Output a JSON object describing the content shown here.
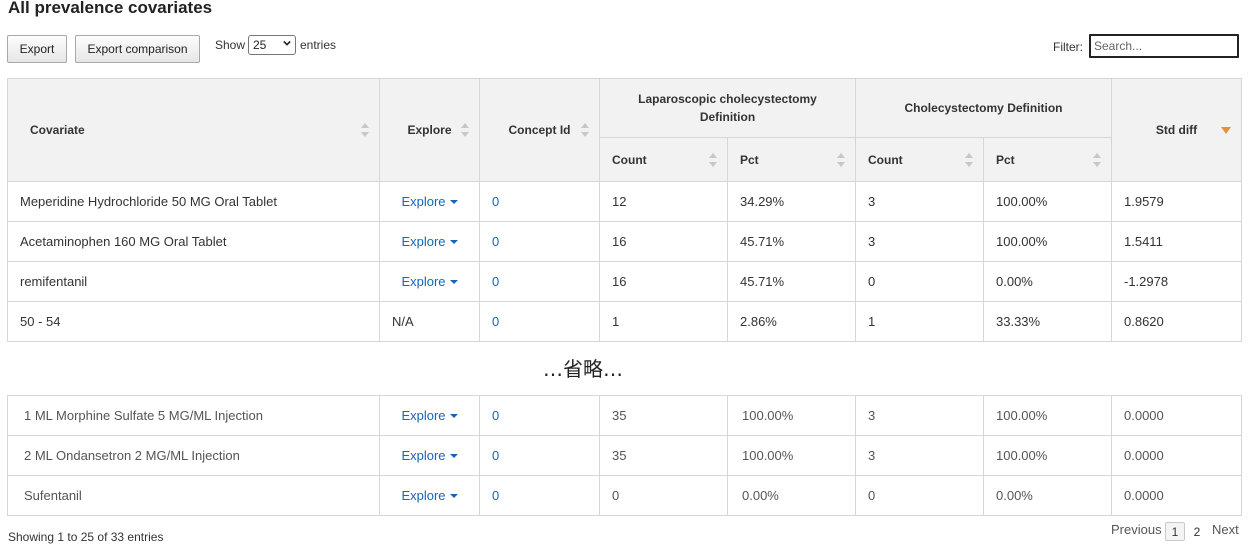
{
  "title": "All prevalence covariates",
  "toolbar": {
    "export_label": "Export",
    "export_comparison_label": "Export comparison",
    "show_label": "Show",
    "entries_value": "25",
    "entries_label": "entries",
    "filter_label": "Filter:",
    "filter_placeholder": "Search..."
  },
  "columns": {
    "covariate": "Covariate",
    "explore": "Explore",
    "concept_id": "Concept Id",
    "group1": "Laparoscopic cholecystectomy Definition",
    "group2": "Cholecystectomy Definition",
    "count": "Count",
    "pct": "Pct",
    "std_diff": "Std diff"
  },
  "rows_top": [
    {
      "covariate": "Meperidine Hydrochloride 50 MG Oral Tablet",
      "explore": "Explore",
      "concept_id": "0",
      "count1": "12",
      "pct1": "34.29%",
      "count2": "3",
      "pct2": "100.00%",
      "std_diff": "1.9579"
    },
    {
      "covariate": "Acetaminophen 160 MG Oral Tablet",
      "explore": "Explore",
      "concept_id": "0",
      "count1": "16",
      "pct1": "45.71%",
      "count2": "3",
      "pct2": "100.00%",
      "std_diff": "1.5411"
    },
    {
      "covariate": "remifentanil",
      "explore": "Explore",
      "concept_id": "0",
      "count1": "16",
      "pct1": "45.71%",
      "count2": "0",
      "pct2": "0.00%",
      "std_diff": "-1.2978"
    },
    {
      "covariate": "50 - 54",
      "explore": "N/A",
      "concept_id": "0",
      "count1": "1",
      "pct1": "2.86%",
      "count2": "1",
      "pct2": "33.33%",
      "std_diff": "0.8620"
    }
  ],
  "omitted_text": "…省略…",
  "rows_bottom": [
    {
      "covariate": "1 ML Morphine Sulfate 5 MG/ML Injection",
      "explore": "Explore",
      "concept_id": "0",
      "count1": "35",
      "pct1": "100.00%",
      "count2": "3",
      "pct2": "100.00%",
      "std_diff": "0.0000"
    },
    {
      "covariate": "2 ML Ondansetron 2 MG/ML Injection",
      "explore": "Explore",
      "concept_id": "0",
      "count1": "35",
      "pct1": "100.00%",
      "count2": "3",
      "pct2": "100.00%",
      "std_diff": "0.0000"
    },
    {
      "covariate": "Sufentanil",
      "explore": "Explore",
      "concept_id": "0",
      "count1": "0",
      "pct1": "0.00%",
      "count2": "0",
      "pct2": "0.00%",
      "std_diff": "0.0000"
    }
  ],
  "footer": {
    "info": "Showing 1 to 25 of 33 entries",
    "previous": "Previous",
    "page1": "1",
    "page2": "2",
    "next": "Next"
  }
}
